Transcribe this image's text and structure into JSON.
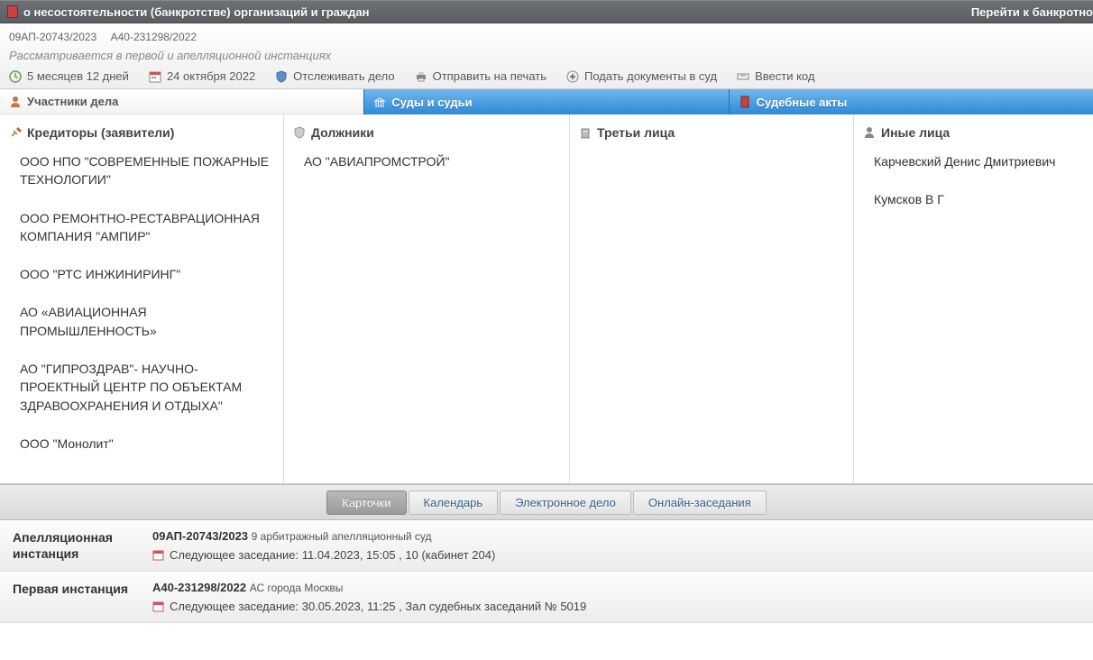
{
  "topbar": {
    "title": "о несостоятельности (банкротстве) организаций и граждан",
    "right_link": "Перейти к банкротно"
  },
  "case": {
    "num1": "09АП-20743/2023",
    "num2": "А40-231298/2022",
    "status": "Рассматривается в первой и апелляционной инстанциях"
  },
  "actions": {
    "duration": "5 месяцев 12 дней",
    "date": "24 октября 2022",
    "track": "Отслеживать дело",
    "print": "Отправить на печать",
    "submit": "Подать документы в суд",
    "code": "Ввести код"
  },
  "tabs": {
    "participants": "Участники дела",
    "courts": "Суды и судьи",
    "acts": "Судебные акты"
  },
  "columns": {
    "creditors": {
      "title": "Кредиторы (заявители)",
      "items": [
        "ООО НПО \"СОВРЕМЕННЫЕ ПОЖАРНЫЕ ТЕХНОЛОГИИ\"",
        "ООО РЕМОНТНО-РЕСТАВРАЦИОННАЯ КОМПАНИЯ \"АМПИР\"",
        "ООО \"РТС ИНЖИНИРИНГ\"",
        "АО «АВИАЦИОННАЯ ПРОМЫШЛЕННОСТЬ»",
        "АО \"ГИПРОЗДРАВ\"- НАУЧНО-ПРОЕКТНЫЙ ЦЕНТР ПО ОБЪЕКТАМ ЗДРАВООХРАНЕНИЯ И ОТДЫХА\"",
        "ООО \"Монолит\""
      ]
    },
    "debtors": {
      "title": "Должники",
      "items": [
        "АО \"АВИАПРОМСТРОЙ\""
      ]
    },
    "third": {
      "title": "Третьи лица",
      "items": []
    },
    "other": {
      "title": "Иные лица",
      "items": [
        "Карчевский Денис Дмитриевич",
        "Кумсков В Г"
      ]
    }
  },
  "bottom_tabs": {
    "cards": "Карточки",
    "calendar": "Календарь",
    "efile": "Электронное дело",
    "online": "Онлайн-заседания"
  },
  "instances": [
    {
      "label": "Апелляционная инстанция",
      "case_num": "09АП-20743/2023",
      "court": "9 арбитражный апелляционный суд",
      "next": "Следующее заседание: 11.04.2023, 15:05 , 10 (кабинет 204)"
    },
    {
      "label": "Первая инстанция",
      "case_num": "А40-231298/2022",
      "court": "АС города Москвы",
      "next": "Следующее заседание: 30.05.2023, 11:25 , Зал судебных заседаний № 5019"
    }
  ]
}
